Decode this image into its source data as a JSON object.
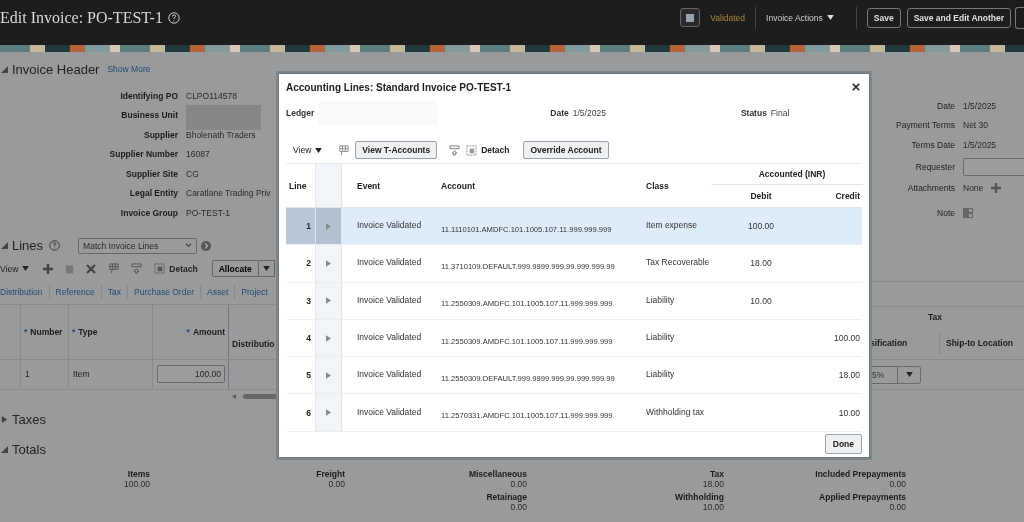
{
  "header": {
    "title": "Edit Invoice: PO-TEST-1",
    "status": "Validated",
    "actions_menu": "Invoice Actions",
    "buttons": [
      "Save",
      "Save and Edit Another"
    ]
  },
  "invoice_header": {
    "title": "Invoice Header",
    "expanded": true,
    "show_more": "Show More",
    "fields": [
      {
        "label": "Identifying PO",
        "value": "CLPO114578",
        "kind": "text"
      },
      {
        "label": "Business Unit",
        "kind": "redacted"
      },
      {
        "label": "Supplier",
        "value": "Bholenath Traders",
        "kind": "text"
      },
      {
        "label": "Supplier Number",
        "value": "16087",
        "kind": "text"
      },
      {
        "label": "Supplier Site",
        "value": "CG",
        "kind": "text"
      },
      {
        "label": "Legal Entity",
        "value": "Caratlane Trading Priv",
        "kind": "text"
      },
      {
        "label": "Invoice Group",
        "value": "PO-TEST-1",
        "kind": "text"
      }
    ],
    "side_fields": [
      {
        "label": "Date",
        "value": "1/5/2025",
        "kind": "text"
      },
      {
        "label": "Payment Terms",
        "value": "Net 30",
        "kind": "text"
      },
      {
        "label": "Terms Date",
        "value": "1/5/2025",
        "kind": "text"
      },
      {
        "label": "Requester",
        "kind": "input"
      },
      {
        "label": "Attachments",
        "value": "None",
        "kind": "attach"
      },
      {
        "label": "Note",
        "kind": "note"
      }
    ]
  },
  "lines": {
    "title": "Lines",
    "expanded": true,
    "match_select": "Match Invoice Lines",
    "view": "View",
    "detach": "Detach",
    "allocate": "Allocate",
    "tabs": [
      "Distribution",
      "Reference",
      "Tax",
      "Purchase Order",
      "Asset",
      "Project"
    ],
    "columns": [
      {
        "label": "Number",
        "required_mark": "*"
      },
      {
        "label": "Type",
        "required_mark": "*"
      },
      {
        "label": "Amount",
        "required_mark": "*"
      },
      {
        "label": "Distributio"
      }
    ],
    "rows": [
      {
        "number": "1",
        "type": "Item",
        "amount": "100.00"
      }
    ],
    "right_group": "Tax",
    "right_columns": [
      "sification",
      "Ship-to Location"
    ],
    "right_row_value": "5%"
  },
  "taxes": {
    "title": "Taxes",
    "expanded": false
  },
  "totals": {
    "title": "Totals",
    "expanded": true,
    "columns": [
      {
        "entries": [
          {
            "label": "Items",
            "value": "100.00"
          }
        ]
      },
      {
        "entries": [
          {
            "label": "Freight",
            "value": "0.00"
          }
        ]
      },
      {
        "entries": [
          {
            "label": "Miscellaneous",
            "value": "0.00"
          },
          {
            "label": "Retainage",
            "value": "0.00"
          }
        ]
      },
      {
        "entries": [
          {
            "label": "Tax",
            "value": "18.00"
          },
          {
            "label": "Withholding",
            "value": "10.00"
          }
        ]
      },
      {
        "entries": [
          {
            "label": "Included Prepayments",
            "value": "0.00"
          },
          {
            "label": "Applied Prepayments",
            "value": "0.00"
          }
        ]
      }
    ]
  },
  "dialog": {
    "title": "Accounting Lines: Standard Invoice PO-TEST-1",
    "ledger_label": "Ledger",
    "date_label": "Date",
    "date": "1/5/2025",
    "status_label": "Status",
    "status": "Final",
    "view": "View",
    "t_accounts": "View T-Accounts",
    "detach": "Detach",
    "override": "Override Account",
    "columns": {
      "line": "Line",
      "event": "Event",
      "account": "Account",
      "class": "Class",
      "group": "Accounted (INR)",
      "debit": "Debit",
      "credit": "Credit"
    },
    "rows": [
      {
        "line": "1",
        "event": "Invoice Validated",
        "account": "11.1110101.AMDFC.101.1005.107.11.999.999.999",
        "class": "Item expense",
        "debit": "100.00",
        "credit": "",
        "selected": true
      },
      {
        "line": "2",
        "event": "Invoice Validated",
        "account": "11.3710109.DEFAULT.999.9999.999.99.999.999.99",
        "class": "Tax Recoverable",
        "debit": "18.00",
        "credit": "",
        "selected": false
      },
      {
        "line": "3",
        "event": "Invoice Validated",
        "account": "11.2550309.AMDFC.101.1005.107.11.999.999.999",
        "class": "Liability",
        "debit": "10.00",
        "credit": "",
        "selected": false
      },
      {
        "line": "4",
        "event": "Invoice Validated",
        "account": "11.2550309.AMDFC.101.1005.107.11.999.999.999",
        "class": "Liability",
        "debit": "",
        "credit": "100.00",
        "selected": false
      },
      {
        "line": "5",
        "event": "Invoice Validated",
        "account": "11.2550309.DEFAULT.999.9999.999.99.999.999.99",
        "class": "Liability",
        "debit": "",
        "credit": "18.00",
        "selected": false
      },
      {
        "line": "6",
        "event": "Invoice Validated",
        "account": "11.2570331.AMDFC.101.1005.107.11.999.999.999",
        "class": "Withholding tax",
        "debit": "",
        "credit": "10.00",
        "selected": false
      }
    ],
    "done": "Done"
  }
}
